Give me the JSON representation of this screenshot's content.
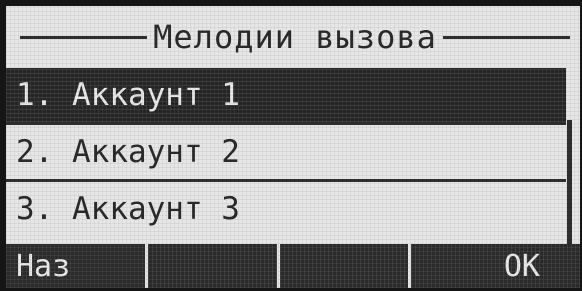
{
  "screen": {
    "title": "Мелодии вызова"
  },
  "menu": {
    "items": [
      {
        "label": "1. Аккаунт 1",
        "selected": true
      },
      {
        "label": "2. Аккаунт 2",
        "selected": false
      },
      {
        "label": "3. Аккаунт 3",
        "selected": false
      }
    ]
  },
  "softkeys": {
    "key1": "Наз",
    "key2": "",
    "key3": "",
    "key4": "OK"
  },
  "colors": {
    "lcd_background": "#e6e6e6",
    "lcd_foreground": "#2a2a2a",
    "highlight": "#262626"
  }
}
